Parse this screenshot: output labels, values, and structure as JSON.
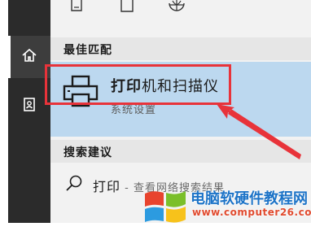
{
  "rail": {
    "items": [
      {
        "icon": "home-icon",
        "selected": true
      },
      {
        "icon": "notebook-icon",
        "selected": false
      }
    ]
  },
  "top_icons": [
    "document-icon",
    "square-icon",
    "globe-icon"
  ],
  "best_match": {
    "header": "最佳匹配",
    "title_bold": "打印",
    "title_rest": "机和扫描仪",
    "subtitle": "系统设置",
    "icon": "printer-icon"
  },
  "suggestions": {
    "header": "搜索建议",
    "items": [
      {
        "text": "打印",
        "sub": " - 查看网络搜索结果",
        "icon": "search-icon"
      }
    ]
  },
  "watermark": {
    "title": "电脑软硬件教程网",
    "url": "www.computer26.com"
  },
  "colors": {
    "rail": "#2b2b2b",
    "panel": "#f2f2f2",
    "selection": "#bcd8ef",
    "annotation": "#e8333a"
  }
}
